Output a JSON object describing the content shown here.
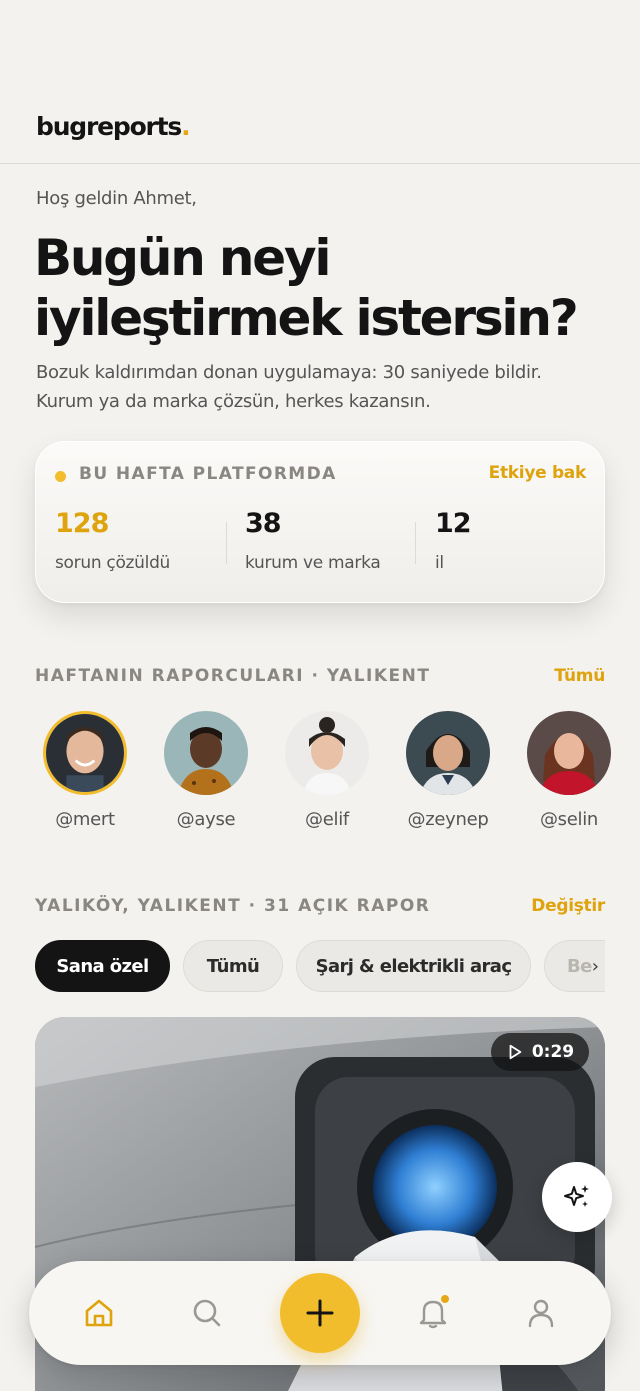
{
  "brand": {
    "logo_text": "bugreports",
    "logo_dot": "."
  },
  "hero": {
    "greeting": "Hoş geldin Ahmet,",
    "headline_line1": "Bugün neyi",
    "headline_line2": "iyileştirmek istersin?",
    "subtitle_line1": "Bozuk kaldırımdan donan uygulamaya: 30 saniyede bildir.",
    "subtitle_line2": "Kurum ya da marka çözsün, herkes kazansın."
  },
  "stats": {
    "label": "BU HAFTA PLATFORMDA",
    "link": "Etkiye bak",
    "items": [
      {
        "value": "128",
        "label": "sorun çözüldü"
      },
      {
        "value": "38",
        "label": "kurum ve marka"
      },
      {
        "value": "12",
        "label": "il"
      }
    ]
  },
  "reporters": {
    "title": "HAFTANIN RAPORCULARI · YALIKENT",
    "link": "Tümü",
    "items": [
      {
        "handle": "@mert"
      },
      {
        "handle": "@ayse"
      },
      {
        "handle": "@elif"
      },
      {
        "handle": "@zeynep"
      },
      {
        "handle": "@selin"
      }
    ]
  },
  "feed": {
    "title": "YALIKÖY, YALIKENT · 31 AÇIK RAPOR",
    "link": "Değiştir",
    "chips": [
      "Sana özel",
      "Tümü",
      "Şarj & elektrikli araç",
      "Be"
    ],
    "card": {
      "duration": "0:29"
    }
  },
  "nav": {
    "items": [
      "home-icon",
      "search-icon",
      "add-icon",
      "bell-icon",
      "profile-icon"
    ]
  },
  "colors": {
    "accent": "#f2bd2c",
    "accent_text": "#dea30d",
    "dark": "#141414",
    "background": "#f3f2ef"
  }
}
